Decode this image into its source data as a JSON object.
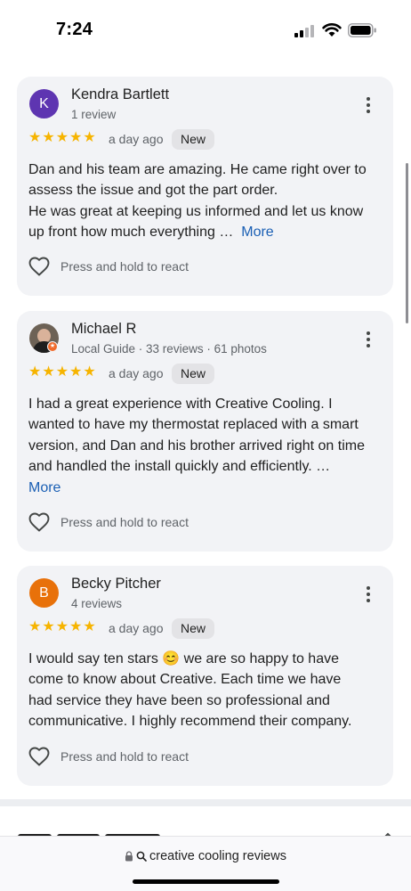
{
  "status_bar": {
    "time": "7:24"
  },
  "reviews": [
    {
      "avatar_letter": "K",
      "avatar_color": "#5e35b1",
      "name": "Kendra Bartlett",
      "meta": "1 review",
      "rating": 5,
      "stars": "★★★★★",
      "time_ago": "a day ago",
      "badge": "New",
      "text_lines": [
        "Dan and his team are amazing. He came right over to",
        "assess the issue and got the part order.",
        "He was great at keeping us informed and let us know",
        "up front how much everything …"
      ],
      "more_label": "More",
      "react_label": "Press and hold to react"
    },
    {
      "avatar_letter": "",
      "avatar_color": "#6d6256",
      "name": "Michael R",
      "meta": "Local Guide · 33 reviews · 61 photos",
      "rating": 5,
      "stars": "★★★★★",
      "time_ago": "a day ago",
      "badge": "New",
      "text_lines": [
        "I had a great experience with Creative Cooling. I",
        "wanted to have my thermostat replaced with a smart",
        "version, and Dan and his brother arrived right on time",
        "and handled the install quickly and efficiently. …"
      ],
      "more_label": "More",
      "react_label": "Press and hold to react"
    },
    {
      "avatar_letter": "B",
      "avatar_color": "#e8710a",
      "name": "Becky Pitcher",
      "meta": "4 reviews",
      "rating": 5,
      "stars": "★★★★★",
      "time_ago": "a day ago",
      "badge": "New",
      "text_lines": [
        "I would say ten stars 😊 we are so happy to have",
        "come to know about Creative. Each time we have",
        "had service they have been so professional and",
        "communicative. I highly recommend their company."
      ],
      "react_label": "Press and hold to react"
    }
  ],
  "address_bar": {
    "text": "creative cooling reviews"
  }
}
